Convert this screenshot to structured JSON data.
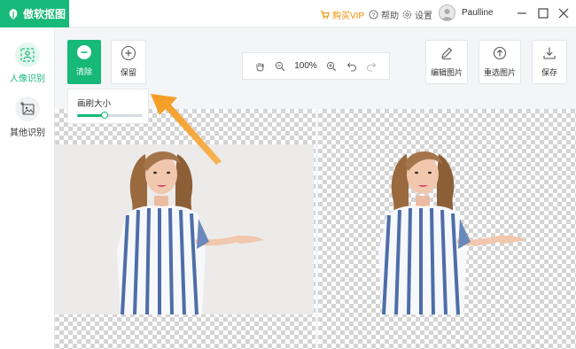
{
  "app": {
    "name": "傲软抠图",
    "logo_icon": "leaf-logo-icon",
    "brand_color": "#17b978"
  },
  "titlebar": {
    "vip_label": "购买VIP",
    "help_label": "帮助",
    "settings_label": "设置",
    "username": "Paulline",
    "vip_color": "#f08c00"
  },
  "sidebar": {
    "items": [
      {
        "label": "人像识别",
        "icon": "portrait-scan-icon",
        "active": true
      },
      {
        "label": "其他识别",
        "icon": "image-add-icon",
        "active": false
      }
    ]
  },
  "toolbar": {
    "clear_label": "清除",
    "keep_label": "保留",
    "zoom_value": "100%",
    "edit_label": "编辑图片",
    "reselect_label": "重选图片",
    "save_label": "保存"
  },
  "brush_popup": {
    "title": "画刷大小",
    "size_fraction": 0.42
  }
}
